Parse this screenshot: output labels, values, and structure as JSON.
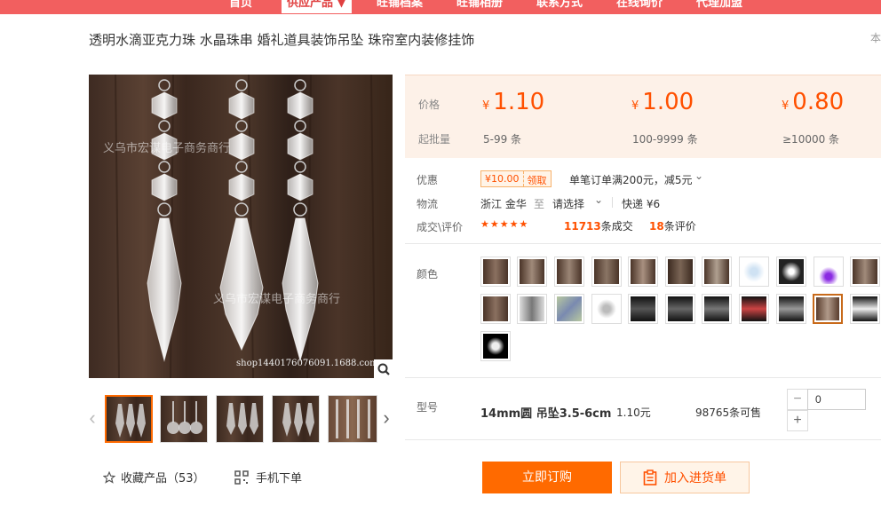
{
  "nav": {
    "items": [
      "首页",
      "供应产品 ▼",
      "旺铺档案",
      "旺铺相册",
      "联系方式",
      "在线询价",
      "代理加盟"
    ]
  },
  "product": {
    "title": "透明水滴亚克力珠 水晶珠串 婚礼道具装饰吊坠 珠帘室内装修挂饰",
    "title_right": "本",
    "watermark_1": "义乌市宏谋电子商务商行",
    "watermark_2": "义乌市宏谋电子商务商行",
    "shop_watermark": "shop1440176076091.1688.com"
  },
  "actions": {
    "favorite_label": "收藏产品（53）",
    "mobile_label": "手机下单"
  },
  "pricing": {
    "price_label": "价格",
    "moq_label": "起批量",
    "currency": "¥",
    "tiers": [
      {
        "price": "1.10",
        "qty": "5-99 条"
      },
      {
        "price": "1.00",
        "qty": "100-9999 条"
      },
      {
        "price": "0.80",
        "qty": "≥10000 条"
      }
    ]
  },
  "promo": {
    "label": "优惠",
    "coupon_amount": "¥10.00",
    "coupon_get": "领取",
    "desc": "单笔订单满200元，减5元"
  },
  "logistics": {
    "label": "物流",
    "from": "浙江 金华",
    "to_word": "至",
    "select": "请选择",
    "express": "快递 ¥6"
  },
  "trade": {
    "label": "成交\\评价",
    "stars": "★★★★★",
    "deals_count": "11713",
    "deals_suffix": "条成交",
    "reviews_count": "18",
    "reviews_suffix": "条评价"
  },
  "color": {
    "label": "颜色"
  },
  "model": {
    "label": "型号",
    "name": "14mm圆 吊坠3.5-6cm",
    "price": "1.10元",
    "stock": "98765条可售",
    "quantity": "0"
  },
  "buttons": {
    "buy": "立即订购",
    "cart": "加入进货单"
  },
  "colors": {
    "accent": "#ff6a00",
    "nav_bg": "#f25f5f",
    "price": "#ff5000"
  }
}
